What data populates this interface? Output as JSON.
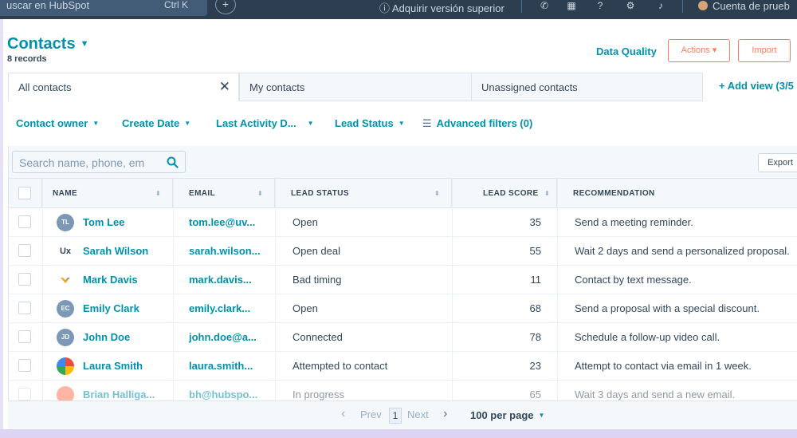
{
  "topnav": {
    "search_placeholder": "uscar en HubSpot",
    "search_shortcut": "Ctrl K",
    "plus_label": "+",
    "upgrade_label": "Adquirir versión superior",
    "account_label": "Cuenta de prueb"
  },
  "header": {
    "title": "Contacts",
    "records": "8 records",
    "data_quality": "Data Quality",
    "actions_label": "Actions ▾",
    "import_label": "Import"
  },
  "tabs": {
    "items": [
      {
        "label": "All contacts"
      },
      {
        "label": "My contacts"
      },
      {
        "label": "Unassigned contacts"
      }
    ],
    "close_glyph": "✕",
    "add_view": "+ Add view (3/5"
  },
  "filters": {
    "contact_owner": "Contact owner",
    "create_date": "Create Date",
    "last_activity": "Last Activity D...",
    "lead_status": "Lead Status",
    "advanced": "Advanced filters (0)"
  },
  "table": {
    "search_placeholder": "Search name, phone, em",
    "export_label": "Export",
    "columns": {
      "name": "NAME",
      "email": "EMAIL",
      "lead_status": "LEAD STATUS",
      "lead_score": "LEAD SCORE",
      "recommendation": "RECOMMENDATION"
    },
    "rows": [
      {
        "initials": "TL",
        "name": "Tom Lee",
        "email": "tom.lee@uv...",
        "status": "Open",
        "score": "35",
        "rec": "Send a meeting reminder."
      },
      {
        "initials": "Ux",
        "name": "Sarah Wilson",
        "email": "sarah.wilson...",
        "status": "Open deal",
        "score": "55",
        "rec": "Wait 2 days and send a personalized proposal."
      },
      {
        "initials": "",
        "name": "Mark Davis",
        "email": "mark.davis...",
        "status": "Bad timing",
        "score": "11",
        "rec": "Contact by text message."
      },
      {
        "initials": "EC",
        "name": "Emily Clark",
        "email": "emily.clark...",
        "status": "Open",
        "score": "68",
        "rec": "Send a proposal with a special discount."
      },
      {
        "initials": "JD",
        "name": "John Doe",
        "email": "john.doe@a...",
        "status": "Connected",
        "score": "78",
        "rec": "Schedule a follow-up video call."
      },
      {
        "initials": "",
        "name": "Laura Smith",
        "email": "laura.smith...",
        "status": "Attempted to contact",
        "score": "23",
        "rec": "Attempt to contact via email in 1 week."
      },
      {
        "initials": "",
        "name": "Brian Halliga...",
        "email": "bh@hubspo...",
        "status": "In progress",
        "score": "65",
        "rec": "Wait 3 days and send a new email."
      }
    ]
  },
  "pager": {
    "prev": "Prev",
    "current": "1",
    "next": "Next",
    "per_page": "100 per page"
  },
  "colors": {
    "accent": "#0091ae",
    "orange": "#ff7a59",
    "nav_bg": "#2d3e50"
  }
}
